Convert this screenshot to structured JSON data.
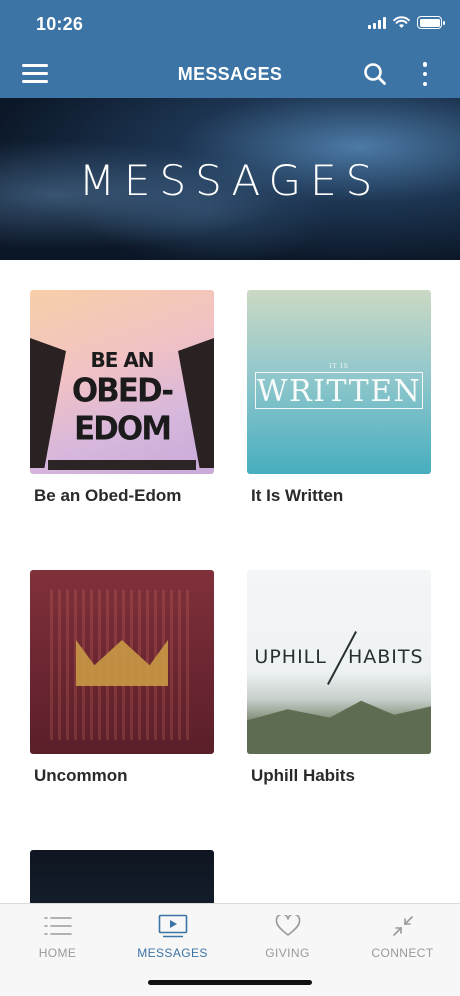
{
  "status_bar": {
    "time": "10:26"
  },
  "nav": {
    "title": "MESSAGES",
    "icons": [
      "hamburger-icon",
      "search-icon",
      "more-vertical-icon"
    ]
  },
  "hero": {
    "title": "MESSAGES"
  },
  "series": [
    {
      "label": "Be an Obed-Edom",
      "art_line1": "BE AN",
      "art_line2": "OBED-EDOM"
    },
    {
      "label": "It Is Written",
      "art_small": "IT IS",
      "art_text": "WRITTEN"
    },
    {
      "label": "Uncommon"
    },
    {
      "label": "Uphill Habits",
      "art_left": "UPHILL",
      "art_right": "HABITS"
    }
  ],
  "tabs": [
    {
      "label": "HOME",
      "icon": "list-icon"
    },
    {
      "label": "MESSAGES",
      "icon": "play-screen-icon",
      "active": true
    },
    {
      "label": "GIVING",
      "icon": "heart-icon"
    },
    {
      "label": "CONNECT",
      "icon": "collapse-arrows-icon"
    }
  ],
  "colors": {
    "accent": "#3d74a6",
    "tab_inactive": "#9a9a9a",
    "label_text": "#2a2a2a"
  }
}
